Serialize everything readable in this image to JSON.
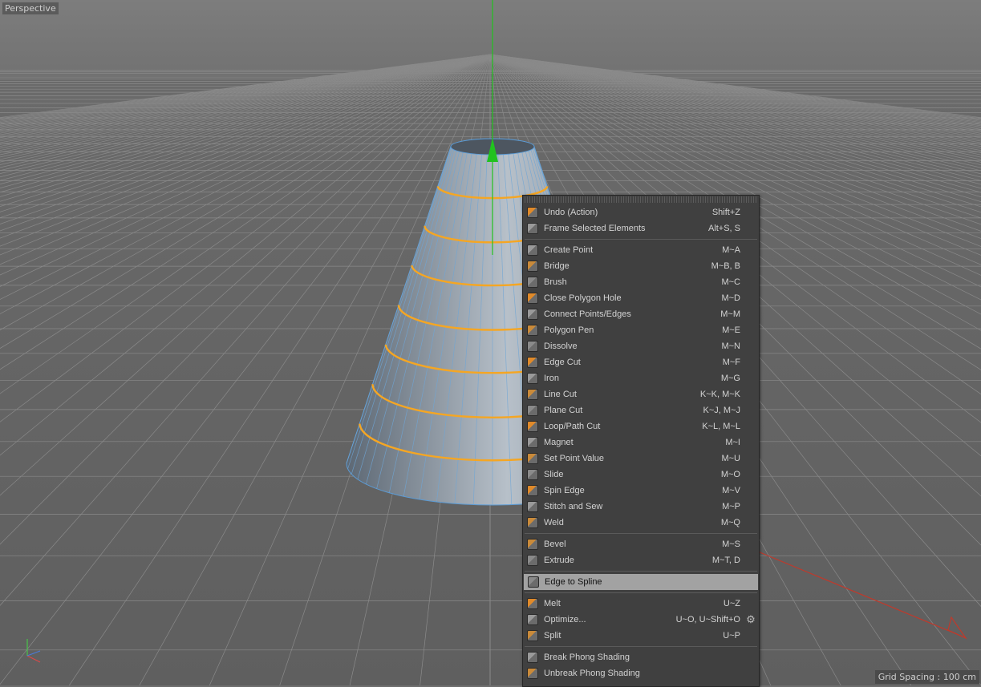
{
  "viewport": {
    "label": "Perspective",
    "grid_spacing": "Grid Spacing : 100 cm",
    "colors": {
      "background": "#6e6e6e",
      "grid": "#8a8a8a",
      "mesh": "#8e9aa6",
      "selected_edge": "#f5a623",
      "y_axis": "#21c21e",
      "x_axis": "#c0392b"
    }
  },
  "menu": {
    "groups": [
      [
        {
          "label": "Undo (Action)",
          "shortcut": "Shift+Z",
          "icon": "undo-icon"
        },
        {
          "label": "Frame Selected Elements",
          "shortcut": "Alt+S, S",
          "icon": "frame-selected-icon"
        }
      ],
      [
        {
          "label": "Create Point",
          "shortcut": "M~A",
          "icon": "create-point-icon"
        },
        {
          "label": "Bridge",
          "shortcut": "M~B, B",
          "icon": "bridge-icon"
        },
        {
          "label": "Brush",
          "shortcut": "M~C",
          "icon": "brush-icon"
        },
        {
          "label": "Close Polygon Hole",
          "shortcut": "M~D",
          "icon": "close-polygon-hole-icon"
        },
        {
          "label": "Connect Points/Edges",
          "shortcut": "M~M",
          "icon": "connect-points-icon"
        },
        {
          "label": "Polygon Pen",
          "shortcut": "M~E",
          "icon": "polygon-pen-icon"
        },
        {
          "label": "Dissolve",
          "shortcut": "M~N",
          "icon": "dissolve-icon"
        },
        {
          "label": "Edge Cut",
          "shortcut": "M~F",
          "icon": "edge-cut-icon"
        },
        {
          "label": "Iron",
          "shortcut": "M~G",
          "icon": "iron-icon"
        },
        {
          "label": "Line Cut",
          "shortcut": "K~K, M~K",
          "icon": "line-cut-icon"
        },
        {
          "label": "Plane Cut",
          "shortcut": "K~J, M~J",
          "icon": "plane-cut-icon"
        },
        {
          "label": "Loop/Path Cut",
          "shortcut": "K~L, M~L",
          "icon": "loop-path-cut-icon"
        },
        {
          "label": "Magnet",
          "shortcut": "M~I",
          "icon": "magnet-icon"
        },
        {
          "label": "Set Point Value",
          "shortcut": "M~U",
          "icon": "set-point-value-icon"
        },
        {
          "label": "Slide",
          "shortcut": "M~O",
          "icon": "slide-icon"
        },
        {
          "label": "Spin Edge",
          "shortcut": "M~V",
          "icon": "spin-edge-icon"
        },
        {
          "label": "Stitch and Sew",
          "shortcut": "M~P",
          "icon": "stitch-and-sew-icon"
        },
        {
          "label": "Weld",
          "shortcut": "M~Q",
          "icon": "weld-icon"
        }
      ],
      [
        {
          "label": "Bevel",
          "shortcut": "M~S",
          "icon": "bevel-icon"
        },
        {
          "label": "Extrude",
          "shortcut": "M~T, D",
          "icon": "extrude-icon"
        }
      ],
      [
        {
          "label": "Edge to Spline",
          "shortcut": "",
          "icon": "edge-to-spline-icon",
          "highlighted": true
        }
      ],
      [
        {
          "label": "Melt",
          "shortcut": "U~Z",
          "icon": "melt-icon"
        },
        {
          "label": "Optimize...",
          "shortcut": "U~O, U~Shift+O",
          "icon": "optimize-icon",
          "has_settings": true
        },
        {
          "label": "Split",
          "shortcut": "U~P",
          "icon": "split-icon"
        }
      ],
      [
        {
          "label": "Break Phong Shading",
          "shortcut": "",
          "icon": "break-phong-icon"
        },
        {
          "label": "Unbreak Phong Shading",
          "shortcut": "",
          "icon": "unbreak-phong-icon"
        }
      ]
    ]
  }
}
